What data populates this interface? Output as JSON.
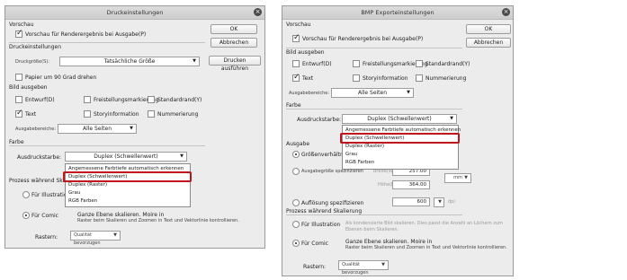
{
  "left": {
    "title": "Druckeinstellungen",
    "ok": "OK",
    "cancel": "Abbrechen",
    "print_button": "Drucken ausführen",
    "preview_section": "Vorschau",
    "preview_checkbox": "Vorschau für Renderergebnis bei Ausgabe(P)",
    "print_settings_section": "Druckeinstellungen",
    "print_size_label": "Druckgröße(S):",
    "print_size_value": "Tatsächliche Größe",
    "rotate_checkbox": "Papier um 90 Grad drehen",
    "output_section": "Bild ausgeben",
    "draft": "Entwurf(D)",
    "crop_marks": "Freistellungsmarkierung",
    "default_border": "Standardrand(Y)",
    "text": "Text",
    "story_info": "Storyinformation",
    "numbering": "Nummerierung",
    "output_range_label": "Ausgabebereiche:",
    "output_range_value": "Alle Seiten",
    "color_section": "Farbe",
    "color_mode_label": "Ausdruckstarbe:",
    "color_mode_value": "Duplex (Schwellenwert)",
    "options": [
      "Angemessene Farbtiefe automatisch erkennen",
      "Duplex (Schwellenwert)",
      "Duplex (Raster)",
      "Grau",
      "RGB Farben"
    ],
    "process_section": "Prozess während Ska",
    "for_illustration": "Für Illustration",
    "for_comic": "Für Comic",
    "comic_desc_1": "Ganze Ebene skalieren. Moire in",
    "comic_desc_2": "Raster beim Skalieren und Zoomen in Text und Vektorlinie kontrollieren.",
    "raster_label": "Rastern:",
    "raster_value": "Qualität bevorzugen"
  },
  "right": {
    "title": "BMP Exporteinstellungen",
    "ok": "OK",
    "cancel": "Abbrechen",
    "preview_section": "Vorschau",
    "preview_checkbox": "Vorschau für Renderergebnis bei Ausgabe(P)",
    "output_section": "Bild ausgeben",
    "draft": "Entwurf(D)",
    "crop_marks": "Freistellungsmarkierung",
    "default_border": "Standardrand(Y)",
    "text": "Text",
    "story_info": "Storyinformation",
    "numbering": "Nummerierung",
    "output_range_label": "Ausgabebereiche:",
    "output_range_value": "Alle Seiten",
    "color_section": "Farbe",
    "color_mode_label": "Ausdruckstarbe:",
    "color_mode_value": "Duplex (Schwellenwert)",
    "options": [
      "Angemessene Farbtiefe automatisch erkennen",
      "Duplex (Schwellenwert)",
      "Duplex (Raster)",
      "Grau",
      "RGB Farben"
    ],
    "output_size_section": "Ausgabe",
    "size_ratio": "Größenverhältnis v",
    "output_size_specify": "Ausgabegröße spezifizieren",
    "width_label": "Breite(W):",
    "width_value": "257.00",
    "height_label": "Höhe(H):",
    "height_value": "364.00",
    "unit_value": "mm",
    "resolution_label": "Auflösung spezifizieren",
    "resolution_value": "600",
    "dpi": "dpi",
    "process_section": "Prozess während Skalierung",
    "for_illustration": "Für Illustration",
    "illu_desc_1": "Als kondensierte Bild skalieren. Dies passt die Anzahl an Löchern zum",
    "illu_desc_2": "Ebenen beim Skalieren.",
    "for_comic": "Für Comic",
    "comic_desc_1": "Ganze Ebene skalieren. Moire in",
    "comic_desc_2": "Raster beim Skalieren und Zoomen in Text und Vektorlinie kontrollieren.",
    "raster_label": "Rastern:",
    "raster_value": "Qualität bevorzugen"
  }
}
